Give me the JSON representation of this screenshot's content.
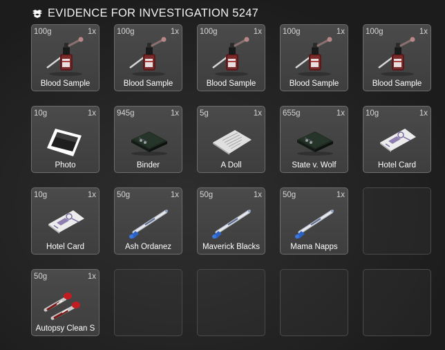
{
  "header": {
    "title": "EVIDENCE FOR INVESTIGATION 5247",
    "icon": "boxes-icon"
  },
  "slots": [
    {
      "weight": "100g",
      "count": "1x",
      "label": "Blood Sample",
      "icon": "blood-sample-icon"
    },
    {
      "weight": "100g",
      "count": "1x",
      "label": "Blood Sample",
      "icon": "blood-sample-icon"
    },
    {
      "weight": "100g",
      "count": "1x",
      "label": "Blood Sample",
      "icon": "blood-sample-icon"
    },
    {
      "weight": "100g",
      "count": "1x",
      "label": "Blood Sample",
      "icon": "blood-sample-icon"
    },
    {
      "weight": "100g",
      "count": "1x",
      "label": "Blood Sample",
      "icon": "blood-sample-icon"
    },
    {
      "weight": "10g",
      "count": "1x",
      "label": "Photo",
      "icon": "photo-icon"
    },
    {
      "weight": "945g",
      "count": "1x",
      "label": "Binder",
      "icon": "binder-icon"
    },
    {
      "weight": "5g",
      "count": "1x",
      "label": "A Doll",
      "icon": "document-icon"
    },
    {
      "weight": "655g",
      "count": "1x",
      "label": "State v. Wolf",
      "icon": "binder-icon"
    },
    {
      "weight": "10g",
      "count": "1x",
      "label": "Hotel Card",
      "icon": "hotel-card-icon"
    },
    {
      "weight": "10g",
      "count": "1x",
      "label": "Hotel Card",
      "icon": "hotel-card-icon"
    },
    {
      "weight": "50g",
      "count": "1x",
      "label": "Ash Ordanez",
      "icon": "swab-icon"
    },
    {
      "weight": "50g",
      "count": "1x",
      "label": "Maverick Blacks",
      "icon": "swab-icon"
    },
    {
      "weight": "50g",
      "count": "1x",
      "label": "Mama Napps",
      "icon": "swab-icon"
    },
    null,
    {
      "weight": "50g",
      "count": "1x",
      "label": "Autopsy Clean S",
      "icon": "blood-tubes-icon"
    },
    null,
    null,
    null,
    null
  ]
}
